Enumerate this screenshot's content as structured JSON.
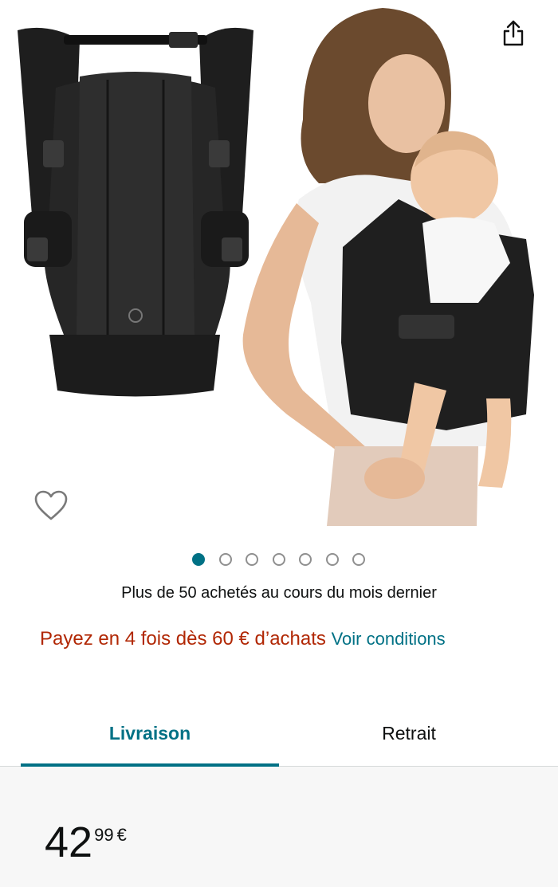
{
  "header": {
    "share_icon": "share-icon",
    "favorite_icon": "heart-outline-icon"
  },
  "gallery": {
    "image_count": 7,
    "active_index": 0,
    "accent_color": "#007185"
  },
  "social_proof": {
    "text": "Plus de 50 achetés au cours du mois dernier"
  },
  "installment": {
    "offer_text": "Payez en 4 fois dès 60 € d’achats",
    "link_text": "Voir conditions",
    "offer_color": "#b12704",
    "link_color": "#007185"
  },
  "tabs": [
    {
      "label": "Livraison",
      "selected": true
    },
    {
      "label": "Retrait",
      "selected": false
    }
  ],
  "price": {
    "whole": "42",
    "fraction": "99",
    "currency": "€"
  }
}
